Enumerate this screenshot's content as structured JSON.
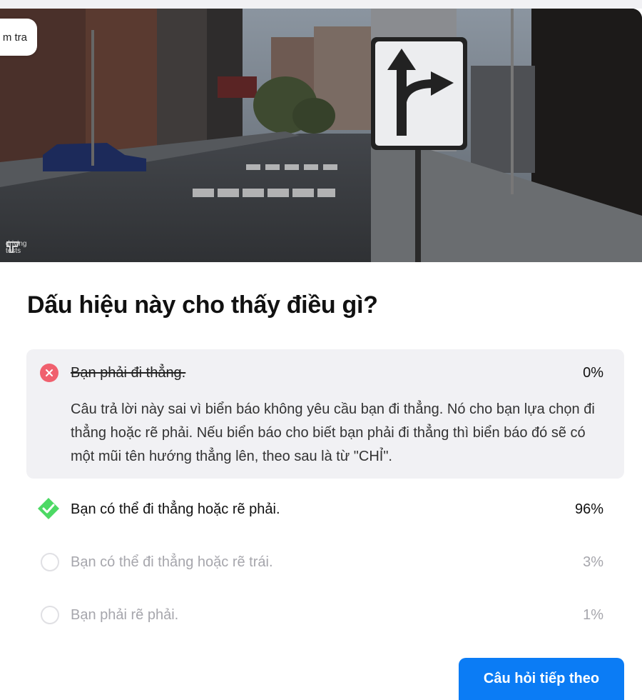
{
  "exam_tab": {
    "label": "m tra"
  },
  "watermark": {
    "text": "driving tests"
  },
  "question": "Dấu hiệu này cho thấy điều gì?",
  "options": [
    {
      "label": "Bạn phải đi thẳng.",
      "percent": "0%",
      "state": "wrong",
      "explanation": "Câu trả lời này sai vì biển báo không yêu cầu bạn đi thẳng. Nó cho bạn lựa chọn đi thẳng hoặc rẽ phải. Nếu biển báo cho biết bạn phải đi thẳng thì biển báo đó sẽ có một mũi tên hướng thẳng lên, theo sau là từ \"CHỈ\"."
    },
    {
      "label": "Bạn có thể đi thẳng hoặc rẽ phải.",
      "percent": "96%",
      "state": "correct"
    },
    {
      "label": "Bạn có thể đi thẳng hoặc rẽ trái.",
      "percent": "3%",
      "state": "unselected"
    },
    {
      "label": "Bạn phải rẽ phải.",
      "percent": "1%",
      "state": "unselected"
    }
  ],
  "next_button": {
    "label": "Câu hỏi tiếp theo"
  },
  "colors": {
    "accent": "#0b7cf5",
    "wrong": "#f0606e",
    "correct": "#4cd964",
    "panel": "#f1f1f4"
  },
  "icons": {
    "wrong": "x-circle-icon",
    "correct": "check-diamond-icon",
    "unselected": "empty-circle-icon",
    "sign": "straight-or-right-arrow-sign-icon"
  }
}
